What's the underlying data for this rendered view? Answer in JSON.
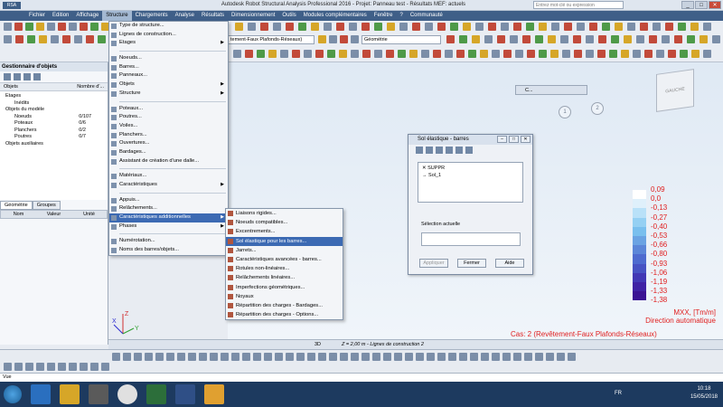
{
  "window": {
    "title": "Autodesk Robot Structural Analysis Professional 2016 - Projet: Panneau test - Résultats MEF: actuels",
    "search_placeholder": "Entrez mot-clé ou expression"
  },
  "menubar": [
    "Fichier",
    "Edition",
    "Affichage",
    "Structure",
    "Chargements",
    "Analyse",
    "Résultats",
    "Dimensionnement",
    "Outils",
    "Modules complémentaires",
    "Fenêtre",
    "?",
    "Communauté"
  ],
  "toolbar": {
    "view_combo": "tement-Faux Plafonds-Réseaux)",
    "layout_combo": "Géométrie"
  },
  "side_panel": {
    "title": "Gestionnaire d'objets",
    "col_objects": "Objets",
    "col_count": "Nombre d'...",
    "tree": [
      {
        "label": "Etages",
        "value": ""
      },
      {
        "label": "Inédits",
        "value": ""
      },
      {
        "label": "Objets du modèle",
        "value": ""
      },
      {
        "label": "Noeuds",
        "value": "0/107"
      },
      {
        "label": "Poteaux",
        "value": "0/6"
      },
      {
        "label": "Planchers",
        "value": "0/2"
      },
      {
        "label": "Poutres",
        "value": "0/7"
      },
      {
        "label": "Objets auxiliaires",
        "value": ""
      }
    ],
    "tab_geometry": "Géométrie",
    "tab_groups": "Groupes",
    "prop_name": "Nom",
    "prop_value": "Valeur",
    "prop_unit": "Unité"
  },
  "structure_menu": {
    "items": [
      {
        "label": "Type de structure...",
        "submenu": false
      },
      {
        "label": "Lignes de construction...",
        "submenu": false
      },
      {
        "label": "Etages",
        "submenu": true
      },
      {
        "sep": true
      },
      {
        "label": "Noeuds...",
        "submenu": false
      },
      {
        "label": "Barres...",
        "submenu": false
      },
      {
        "label": "Panneaux...",
        "submenu": false
      },
      {
        "label": "Objets",
        "submenu": true
      },
      {
        "label": "Structure",
        "submenu": true
      },
      {
        "sep": true
      },
      {
        "label": "Poteaux...",
        "submenu": false
      },
      {
        "label": "Poutres...",
        "submenu": false
      },
      {
        "label": "Voiles...",
        "submenu": false
      },
      {
        "label": "Planchers...",
        "submenu": false
      },
      {
        "label": "Ouvertures...",
        "submenu": false
      },
      {
        "label": "Bardages...",
        "submenu": false
      },
      {
        "label": "Assistant de création d'une dalle...",
        "submenu": false
      },
      {
        "sep": true
      },
      {
        "label": "Matériaux...",
        "submenu": false
      },
      {
        "label": "Caractéristiques",
        "submenu": true
      },
      {
        "sep": true
      },
      {
        "label": "Appuis...",
        "submenu": false
      },
      {
        "label": "Relâchements...",
        "submenu": false
      },
      {
        "label": "Caractéristiques additionnelles",
        "submenu": true,
        "highlight": true
      },
      {
        "label": "Phases",
        "submenu": true
      },
      {
        "sep": true
      },
      {
        "label": "Numérotation...",
        "submenu": false
      },
      {
        "label": "Noms des barres/objets...",
        "submenu": false
      }
    ]
  },
  "additional_submenu": {
    "items": [
      {
        "label": "Liaisons rigides..."
      },
      {
        "label": "Noeuds compatibles..."
      },
      {
        "label": "Excentrements..."
      },
      {
        "label": "Sol élastique pour les barres...",
        "highlight": true
      },
      {
        "label": "Jarrets..."
      },
      {
        "label": "Caractéristiques avancées - barres..."
      },
      {
        "label": "Rotules non-linéaires..."
      },
      {
        "label": "Relâchements linéaires..."
      },
      {
        "label": "Imperfections géométriques..."
      },
      {
        "label": "Noyaux"
      },
      {
        "label": "Répartition des charges - Bardages..."
      },
      {
        "label": "Répartition des charges - Options..."
      }
    ]
  },
  "mini_toolbar_label": "C...",
  "grid_labels": [
    "1",
    "2"
  ],
  "cube_label": "GAUCHE",
  "dialog": {
    "title": "Sol élastique - barres",
    "list_items": [
      "SUPPR",
      "Sol_1"
    ],
    "selection_label": "Sélection actuelle",
    "btn_apply": "Appliquer",
    "btn_close": "Fermer",
    "btn_help": "Aide"
  },
  "legend": {
    "values": [
      "0,09",
      "0,0",
      "-0,13",
      "-0,27",
      "-0,40",
      "-0,53",
      "-0,66",
      "-0,80",
      "-0,93",
      "-1,06",
      "-1,19",
      "-1,33",
      "-1,38"
    ],
    "colors": [
      "#ffffff",
      "#dff0fb",
      "#b9e1f8",
      "#95d0f3",
      "#79bfee",
      "#6aa3e3",
      "#5b86d8",
      "#4e6bcf",
      "#4753c3",
      "#4238b5",
      "#3f22a5",
      "#3a1394"
    ],
    "unit_label": "MXX, [Tm/m]",
    "direction_label": "Direction automatique",
    "case_label": "Cas: 2 (Revêtement-Faux Plafonds-Réseaux)"
  },
  "axes": {
    "x": "X",
    "y": "Y",
    "z": "Z"
  },
  "status": {
    "mode": "3D",
    "z_info": "Z = 2,00 m - Lignes de construction 2"
  },
  "command_prompt": "Vue",
  "taskbar": {
    "lang": "FR",
    "time": "10:18",
    "date": "15/05/2018"
  }
}
